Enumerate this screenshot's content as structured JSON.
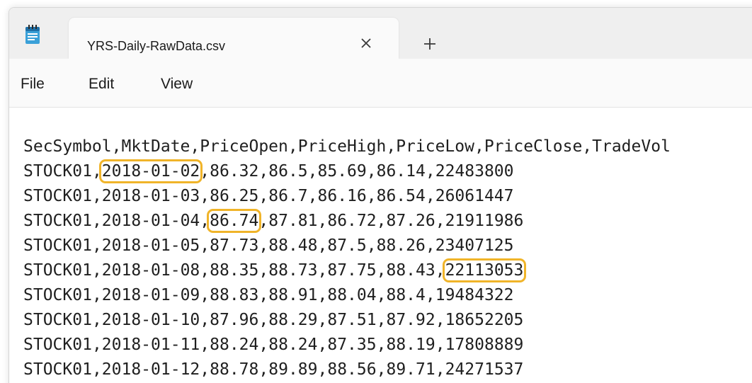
{
  "tab": {
    "title": "YRS-Daily-RawData.csv",
    "close_icon": "close-icon",
    "new_tab_icon": "plus-icon"
  },
  "app_icon": "notepad-icon",
  "menu": {
    "file": "File",
    "edit": "Edit",
    "view": "View"
  },
  "highlight_color": "#f0b429",
  "csv": {
    "header": "SecSymbol,MktDate,PriceOpen,PriceHigh,PriceLow,PriceClose,TradeVol",
    "rows": [
      {
        "symbol": "STOCK01",
        "date": "2018-01-02",
        "open": "86.32",
        "high": "86.5",
        "low": "85.69",
        "close": "86.14",
        "volume": "22483800"
      },
      {
        "symbol": "STOCK01",
        "date": "2018-01-03",
        "open": "86.25",
        "high": "86.7",
        "low": "86.16",
        "close": "86.54",
        "volume": "26061447"
      },
      {
        "symbol": "STOCK01",
        "date": "2018-01-04",
        "open": "86.74",
        "high": "87.81",
        "low": "86.72",
        "close": "87.26",
        "volume": "21911986"
      },
      {
        "symbol": "STOCK01",
        "date": "2018-01-05",
        "open": "87.73",
        "high": "88.48",
        "low": "87.5",
        "close": "88.26",
        "volume": "23407125"
      },
      {
        "symbol": "STOCK01",
        "date": "2018-01-08",
        "open": "88.35",
        "high": "88.73",
        "low": "87.75",
        "close": "88.43",
        "volume": "22113053"
      },
      {
        "symbol": "STOCK01",
        "date": "2018-01-09",
        "open": "88.83",
        "high": "88.91",
        "low": "88.04",
        "close": "88.4",
        "volume": "19484322"
      },
      {
        "symbol": "STOCK01",
        "date": "2018-01-10",
        "open": "87.96",
        "high": "88.29",
        "low": "87.51",
        "close": "87.92",
        "volume": "18652205"
      },
      {
        "symbol": "STOCK01",
        "date": "2018-01-11",
        "open": "88.24",
        "high": "88.24",
        "low": "87.35",
        "close": "88.19",
        "volume": "17808889"
      },
      {
        "symbol": "STOCK01",
        "date": "2018-01-12",
        "open": "88.78",
        "high": "89.89",
        "low": "88.56",
        "close": "89.71",
        "volume": "24271537"
      }
    ]
  },
  "highlights": [
    {
      "row": 0,
      "field": "date"
    },
    {
      "row": 2,
      "field": "open"
    },
    {
      "row": 4,
      "field": "volume"
    }
  ]
}
